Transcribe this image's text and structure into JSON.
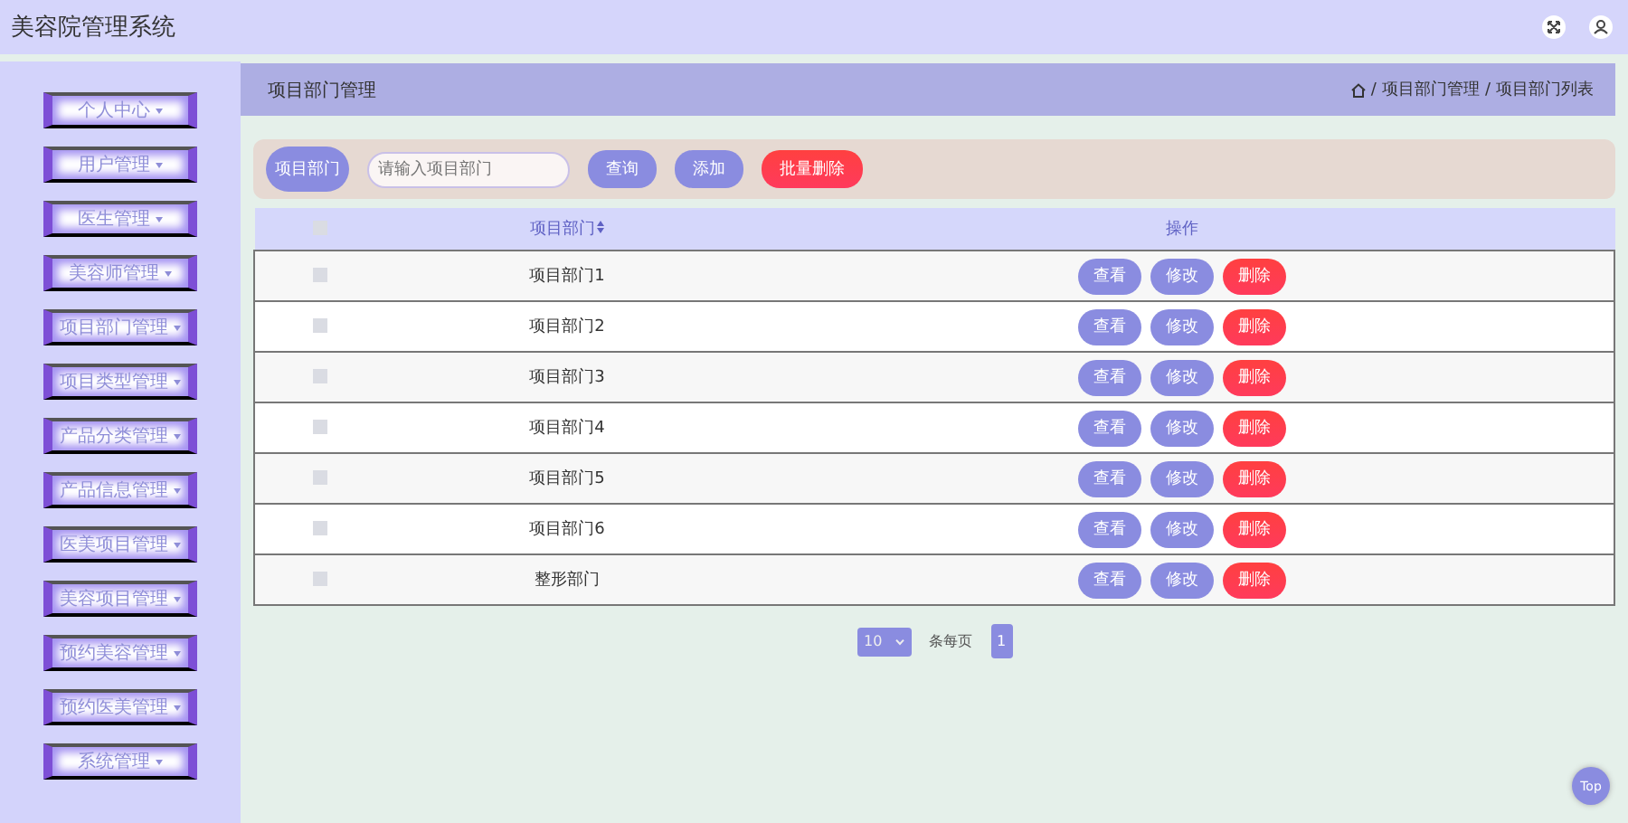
{
  "header": {
    "title": "美容院管理系统"
  },
  "sidebar": {
    "items": [
      {
        "label": "个人中心"
      },
      {
        "label": "用户管理"
      },
      {
        "label": "医生管理"
      },
      {
        "label": "美容师管理"
      },
      {
        "label": "项目部门管理"
      },
      {
        "label": "项目类型管理"
      },
      {
        "label": "产品分类管理"
      },
      {
        "label": "产品信息管理"
      },
      {
        "label": "医美项目管理"
      },
      {
        "label": "美容项目管理"
      },
      {
        "label": "预约美容管理"
      },
      {
        "label": "预约医美管理"
      },
      {
        "label": "系统管理"
      }
    ]
  },
  "page_title": "项目部门管理",
  "breadcrumb": {
    "separator": "/",
    "items": [
      "项目部门管理",
      "项目部门列表"
    ]
  },
  "search": {
    "label": "项目部门",
    "placeholder": "请输入项目部门",
    "buttons": [
      {
        "label": "查询",
        "kind": "primary"
      },
      {
        "label": "添加",
        "kind": "primary"
      },
      {
        "label": "批量删除",
        "kind": "danger"
      }
    ]
  },
  "table": {
    "header_checked": false,
    "columns": [
      "项目部门",
      "操作"
    ],
    "rows": [
      {
        "checked": false,
        "name": "项目部门1",
        "actions": [
          {
            "label": "查看",
            "kind": "primary"
          },
          {
            "label": "修改",
            "kind": "primary"
          },
          {
            "label": "删除",
            "kind": "danger"
          }
        ]
      },
      {
        "checked": false,
        "name": "项目部门2",
        "actions": [
          {
            "label": "查看",
            "kind": "primary"
          },
          {
            "label": "修改",
            "kind": "primary"
          },
          {
            "label": "删除",
            "kind": "danger"
          }
        ]
      },
      {
        "checked": false,
        "name": "项目部门3",
        "actions": [
          {
            "label": "查看",
            "kind": "primary"
          },
          {
            "label": "修改",
            "kind": "primary"
          },
          {
            "label": "删除",
            "kind": "danger"
          }
        ]
      },
      {
        "checked": false,
        "name": "项目部门4",
        "actions": [
          {
            "label": "查看",
            "kind": "primary"
          },
          {
            "label": "修改",
            "kind": "primary"
          },
          {
            "label": "删除",
            "kind": "danger"
          }
        ]
      },
      {
        "checked": false,
        "name": "项目部门5",
        "actions": [
          {
            "label": "查看",
            "kind": "primary"
          },
          {
            "label": "修改",
            "kind": "primary"
          },
          {
            "label": "删除",
            "kind": "danger"
          }
        ]
      },
      {
        "checked": false,
        "name": "项目部门6",
        "actions": [
          {
            "label": "查看",
            "kind": "primary"
          },
          {
            "label": "修改",
            "kind": "primary"
          },
          {
            "label": "删除",
            "kind": "danger"
          }
        ]
      },
      {
        "checked": false,
        "name": "整形部门",
        "actions": [
          {
            "label": "查看",
            "kind": "primary"
          },
          {
            "label": "修改",
            "kind": "primary"
          },
          {
            "label": "删除",
            "kind": "danger"
          }
        ]
      }
    ]
  },
  "pager": {
    "page_size": "10",
    "per_page_label": "条每页",
    "pages": [
      {
        "label": "1",
        "selected": true
      }
    ]
  },
  "back_to_top": "Top"
}
